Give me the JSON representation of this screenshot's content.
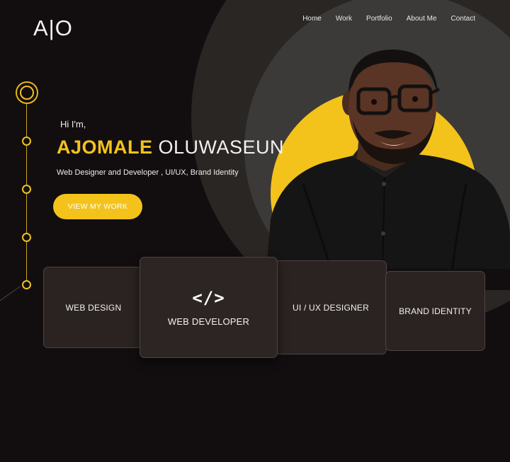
{
  "brand": {
    "logo_text": "A|O"
  },
  "nav": {
    "items": [
      {
        "label": "Home"
      },
      {
        "label": "Work"
      },
      {
        "label": "Portfolio"
      },
      {
        "label": "About Me"
      },
      {
        "label": "Contact"
      }
    ]
  },
  "hero": {
    "greeting": "Hi I'm,",
    "first_name": "AJOMALE",
    "last_name": "OLUWASEUN",
    "tagline": "Web Designer and Developer , UI/UX, Brand Identity",
    "cta_label": "VIEW MY WORK"
  },
  "services": [
    {
      "label": "WEB DESIGN"
    },
    {
      "label": "WEB DEVELOPER",
      "icon": "code-icon",
      "icon_glyph": "</>"
    },
    {
      "label": "UI / UX DESIGNER"
    },
    {
      "label": "BRAND IDENTITY"
    }
  ],
  "colors": {
    "accent": "#f3c31c",
    "background": "#120e10",
    "card": "#2a2321"
  }
}
